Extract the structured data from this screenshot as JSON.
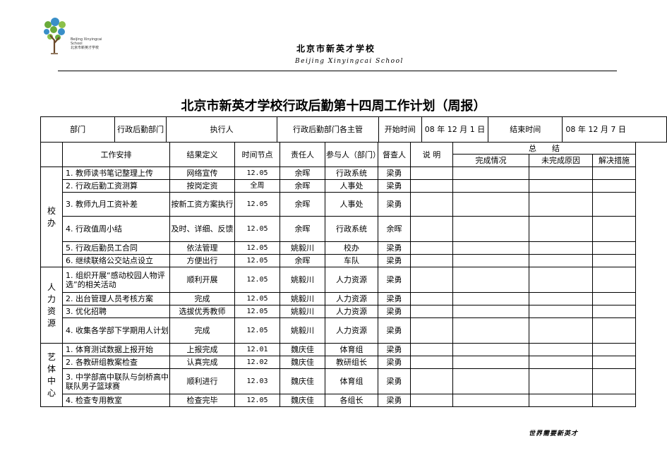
{
  "header": {
    "logo_text_en": "Beijing Xinyingcai School",
    "logo_text_cn": "北京市新英才学校",
    "school_cn": "北京市新英才学校",
    "school_en": "Beijing Xinyingcai School"
  },
  "title": "北京市新英才学校行政后勤第十四周工作计划（周报）",
  "info_row": {
    "dept_label": "部门",
    "dept_value": "行政后勤部门",
    "executor_label": "执行人",
    "executor_value": "行政后勤部门各主管",
    "start_label": "开始时间",
    "start_value": "08 年 12 月 1 日",
    "end_label": "结束时间",
    "end_value": "08 年 12 月 7 日"
  },
  "columns": {
    "work": "工作安排",
    "result": "结果定义",
    "time": "时间节点",
    "owner": "责任人",
    "participant": "参与人（部门）",
    "checker": "督查人",
    "note": "说 明",
    "summary": "总　　结",
    "done": "完成情况",
    "undone": "未完成原因",
    "solution": "解决措施"
  },
  "departments": [
    {
      "name": "校办",
      "rows": [
        {
          "task": "1. 教师读书笔记整理上传",
          "result": "网络宣传",
          "time": "12.05",
          "owner": "余晖",
          "participant": "行政系统",
          "checker": "梁勇"
        },
        {
          "task": "2. 行政后勤工资测算",
          "result": "按岗定资",
          "time": "全周",
          "owner": "余晖",
          "participant": "人事处",
          "checker": "梁勇"
        },
        {
          "task": "3. 教师九月工资补差",
          "result": "按新工资方案执行",
          "time": "12.05",
          "owner": "余晖",
          "participant": "人事处",
          "checker": "梁勇"
        },
        {
          "task": "4. 行政值周小结",
          "result": "及时、详细、反馈",
          "time": "12.05",
          "owner": "余晖",
          "participant": "行政系统",
          "checker": "余晖"
        },
        {
          "task": "5. 行政后勤员工合同",
          "result": "依法管理",
          "time": "12.05",
          "owner": "姚毅川",
          "participant": "校办",
          "checker": "梁勇"
        },
        {
          "task": "6. 继续联络公交站点设立",
          "result": "方便出行",
          "time": "12.05",
          "owner": "余晖",
          "participant": "车队",
          "checker": "梁勇"
        }
      ]
    },
    {
      "name": "人力资源",
      "rows": [
        {
          "task": "1. 组织开展“感动校园人物评选”的相关活动",
          "result": "顺利开展",
          "time": "12.05",
          "owner": "姚毅川",
          "participant": "人力资源",
          "checker": "梁勇"
        },
        {
          "task": "2. 出台管理人员考核方案",
          "result": "完成",
          "time": "12.05",
          "owner": "姚毅川",
          "participant": "人力资源",
          "checker": "梁勇"
        },
        {
          "task": "3. 优化招聘",
          "result": "选拔优秀教师",
          "time": "12.05",
          "owner": "姚毅川",
          "participant": "人力资源",
          "checker": "梁勇"
        },
        {
          "task": "4. 收集各学部下学期用人计划",
          "result": "完成",
          "time": "12.05",
          "owner": "姚毅川",
          "participant": "人力资源",
          "checker": "梁勇"
        }
      ]
    },
    {
      "name": "艺体中心",
      "rows": [
        {
          "task": "1. 体育测试数据上报开始",
          "result": "上报完成",
          "time": "12.01",
          "owner": "魏庆佳",
          "participant": "体育组",
          "checker": "梁勇"
        },
        {
          "task": "2. 各教研组教案检查",
          "result": "认真完成",
          "time": "12.02",
          "owner": "魏庆佳",
          "participant": "教研组长",
          "checker": "梁勇"
        },
        {
          "task": "3. 中学部高中联队与剑桥高中联队男子篮球赛",
          "result": "顺利进行",
          "time": "12.03",
          "owner": "魏庆佳",
          "participant": "体育组",
          "checker": "梁勇"
        },
        {
          "task": "4. 检查专用教室",
          "result": "检查完毕",
          "time": "12.05",
          "owner": "魏庆佳",
          "participant": "各组长",
          "checker": "梁勇"
        }
      ]
    }
  ],
  "footer": "世界需要新英才",
  "colors": {
    "leaf_green": "#6aab3a",
    "leaf_blue": "#3a8fc8",
    "trunk": "#6b4a2a"
  }
}
